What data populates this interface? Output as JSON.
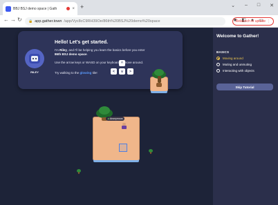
{
  "browser": {
    "tab_title": "BBJ BSJ demo space | Gath",
    "new_tab": "+",
    "tab_close": "×",
    "url_host": "app.gather.town",
    "url_path": "/app/Vyc8cC9RH39Oe/86th%20BSJ%20demo%20space",
    "update_label": "Relaunch to update",
    "window_controls": [
      "⌄",
      "–",
      "□",
      "✕"
    ]
  },
  "card": {
    "title": "Hello! Let's get started.",
    "bot_name": "RILEY",
    "line1_prefix": "I'm ",
    "line1_name": "Riley",
    "line1_mid": ", and I'll be helping you learn the basics before you enter ",
    "line1_space": "86th BSJ demo space",
    "line1_end": ".",
    "line2": "Use the arrow keys or WASD on your keyboard to move around.",
    "line3_prefix": "Try walking to the ",
    "line3_highlight": "glowing",
    "line3_suffix": " tile!",
    "keys": {
      "up": "^",
      "left": "<",
      "down": "v",
      "right": ">"
    }
  },
  "game": {
    "player_name": "Anonymous"
  },
  "sidebar": {
    "title": "Welcome to Gather!",
    "section": "BASICS",
    "items": [
      {
        "label": "Moving around",
        "active": true
      },
      {
        "label": "Muting and unmuting",
        "active": false
      },
      {
        "label": "Interacting with objects",
        "active": false
      }
    ],
    "skip_label": "Skip Tutorial"
  },
  "colors": {
    "sidebar_bg": "#2b2f4b",
    "game_bg": "#1d2338",
    "card_bg": "#2e3459",
    "active_accent": "#f2c94c",
    "glow_accent": "#5b9cff"
  }
}
